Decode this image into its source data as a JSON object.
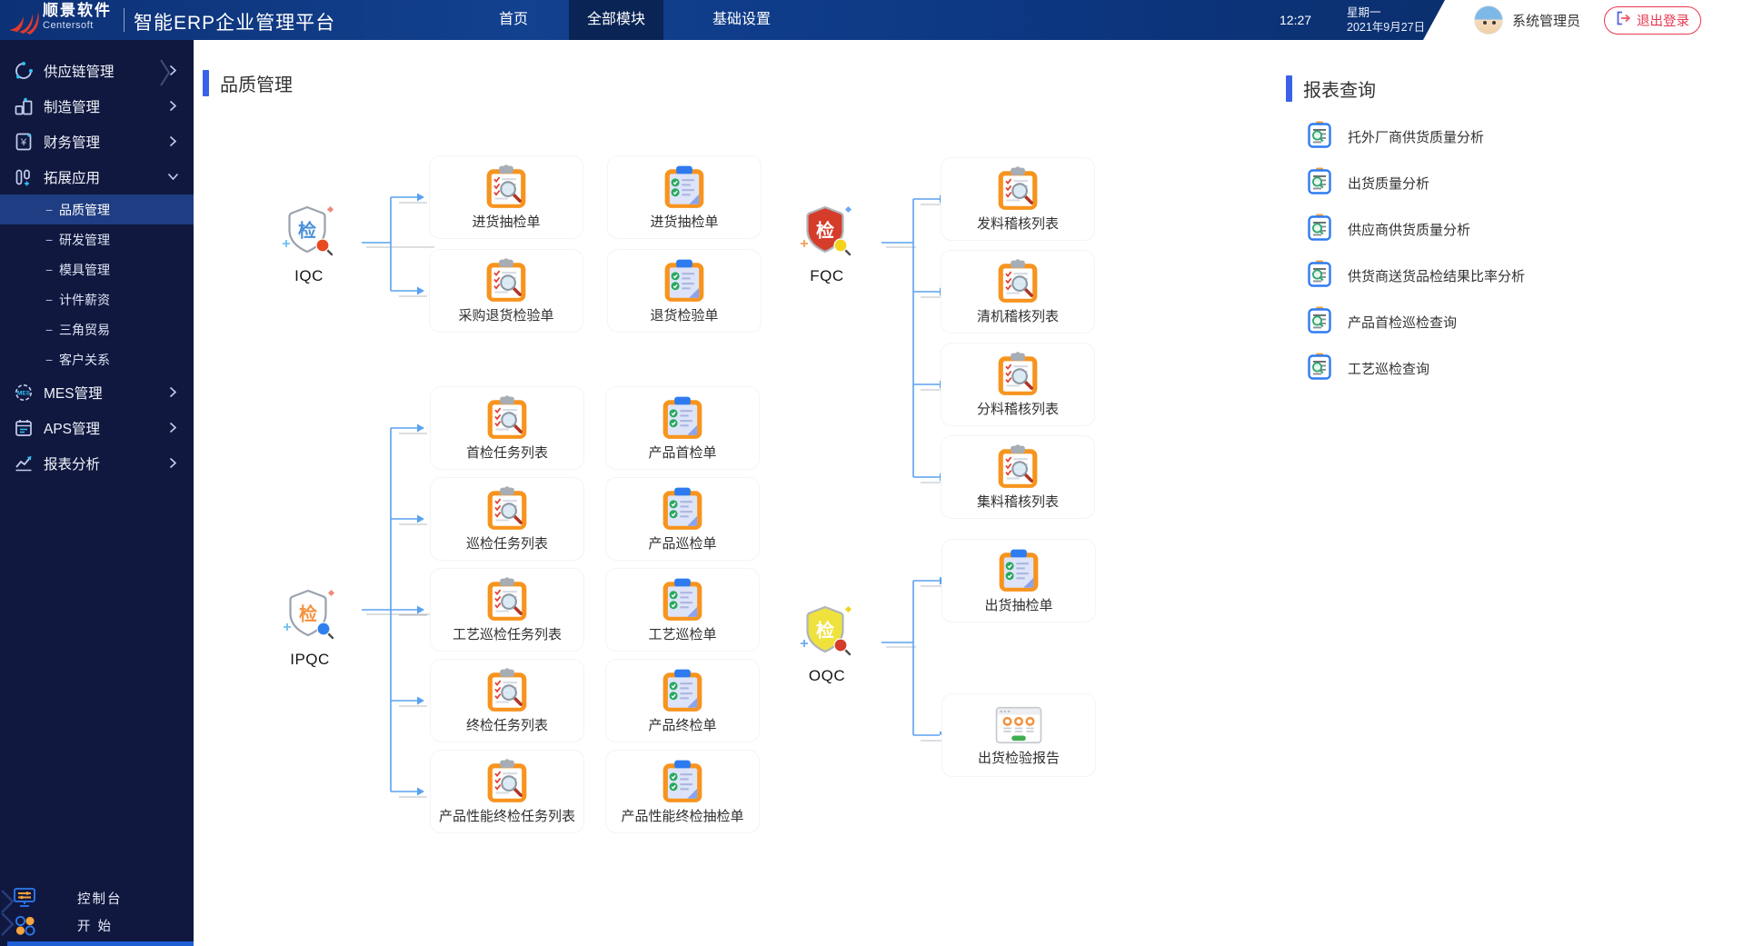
{
  "topbar": {
    "logo": {
      "name": "顺景软件",
      "sub": "Centersoft",
      "icon": "centersoft-swoosh-logo"
    },
    "app_title": "智能ERP企业管理平台",
    "nav": [
      {
        "label": "首页",
        "active": false
      },
      {
        "label": "全部模块",
        "active": true
      },
      {
        "label": "基础设置",
        "active": false
      }
    ],
    "time": "12:27",
    "weekday": "星期一",
    "date": "2021年9月27日",
    "username": "系统管理员",
    "logout_label": "退出登录",
    "logout_icon": "logout-icon",
    "accent_red": "#e8384f"
  },
  "sidebar": {
    "items": [
      {
        "label": "供应链管理",
        "icon": "supply-chain-icon",
        "chevron": "right"
      },
      {
        "label": "制造管理",
        "icon": "manufacturing-icon",
        "chevron": "right"
      },
      {
        "label": "财务管理",
        "icon": "finance-icon",
        "chevron": "right"
      },
      {
        "label": "拓展应用",
        "icon": "extension-icon",
        "chevron": "down",
        "expanded": true,
        "children": [
          {
            "label": "品质管理",
            "active": true
          },
          {
            "label": "研发管理",
            "active": false
          },
          {
            "label": "模具管理",
            "active": false
          },
          {
            "label": "计件薪资",
            "active": false
          },
          {
            "label": "三角贸易",
            "active": false
          },
          {
            "label": "客户关系",
            "active": false
          }
        ]
      },
      {
        "label": "MES管理",
        "icon": "mes-icon",
        "chevron": "right"
      },
      {
        "label": "APS管理",
        "icon": "aps-icon",
        "chevron": "right"
      },
      {
        "label": "报表分析",
        "icon": "report-analysis-icon",
        "chevron": "right"
      }
    ],
    "footer": [
      {
        "label": "控制台",
        "icon": "console-icon"
      },
      {
        "label": "开 始",
        "icon": "start-icon"
      }
    ],
    "active_bg": "#1f3d82"
  },
  "main": {
    "title": "品质管理",
    "flow": {
      "nodes": [
        {
          "id": "iqc",
          "label": "IQC",
          "variant": "iqc",
          "icon": "shield-check-icon"
        },
        {
          "id": "fqc",
          "label": "FQC",
          "variant": "fqc",
          "icon": "shield-check-icon"
        },
        {
          "id": "ipqc",
          "label": "IPQC",
          "variant": "ipqc",
          "icon": "shield-check-icon"
        },
        {
          "id": "oqc",
          "label": "OQC",
          "variant": "oqc",
          "icon": "shield-check-icon"
        }
      ],
      "columns": [
        {
          "id": "iqc-col1",
          "icon": "inspection-list",
          "items": [
            "进货抽检单",
            "采购退货检验单"
          ]
        },
        {
          "id": "iqc-col2",
          "icon": "inspection-form",
          "items": [
            "进货抽检单",
            "退货检验单"
          ]
        },
        {
          "id": "fqc-col",
          "icon": "inspection-list",
          "items": [
            "发料稽核列表",
            "清机稽核列表",
            "分料稽核列表",
            "集料稽核列表"
          ]
        },
        {
          "id": "ipqc-col1",
          "icon": "inspection-list",
          "items": [
            "首检任务列表",
            "巡检任务列表",
            "工艺巡检任务列表",
            "终检任务列表",
            "产品性能终检任务列表"
          ]
        },
        {
          "id": "ipqc-col2",
          "icon": "inspection-form",
          "items": [
            "产品首检单",
            "产品巡检单",
            "工艺巡检单",
            "产品终检单",
            "产品性能终检抽检单"
          ]
        },
        {
          "id": "oqc-col",
          "icon": "inspection-form",
          "items": [
            {
              "label": "出货抽检单",
              "icon": "inspection-form"
            },
            {
              "label": "出货检验报告",
              "icon": "report-window"
            }
          ]
        }
      ]
    }
  },
  "right_panel": {
    "title": "报表查询",
    "item_icon": "report-query-icon",
    "items": [
      "托外厂商供货质量分析",
      "出货质量分析",
      "供应商供货质量分析",
      "供货商送货品检结果比率分析",
      "产品首检巡检查询",
      "工艺巡检查询"
    ]
  },
  "colors": {
    "topbar_blue": "#0d3884",
    "sidebar_navy": "#10183f",
    "title_accent": "#3a62e8",
    "connector_blue": "#5aa2ef",
    "clipboard_orange": "#f7941e",
    "form_clip_blue": "#2e7bf0",
    "check_green": "#27a85c"
  }
}
